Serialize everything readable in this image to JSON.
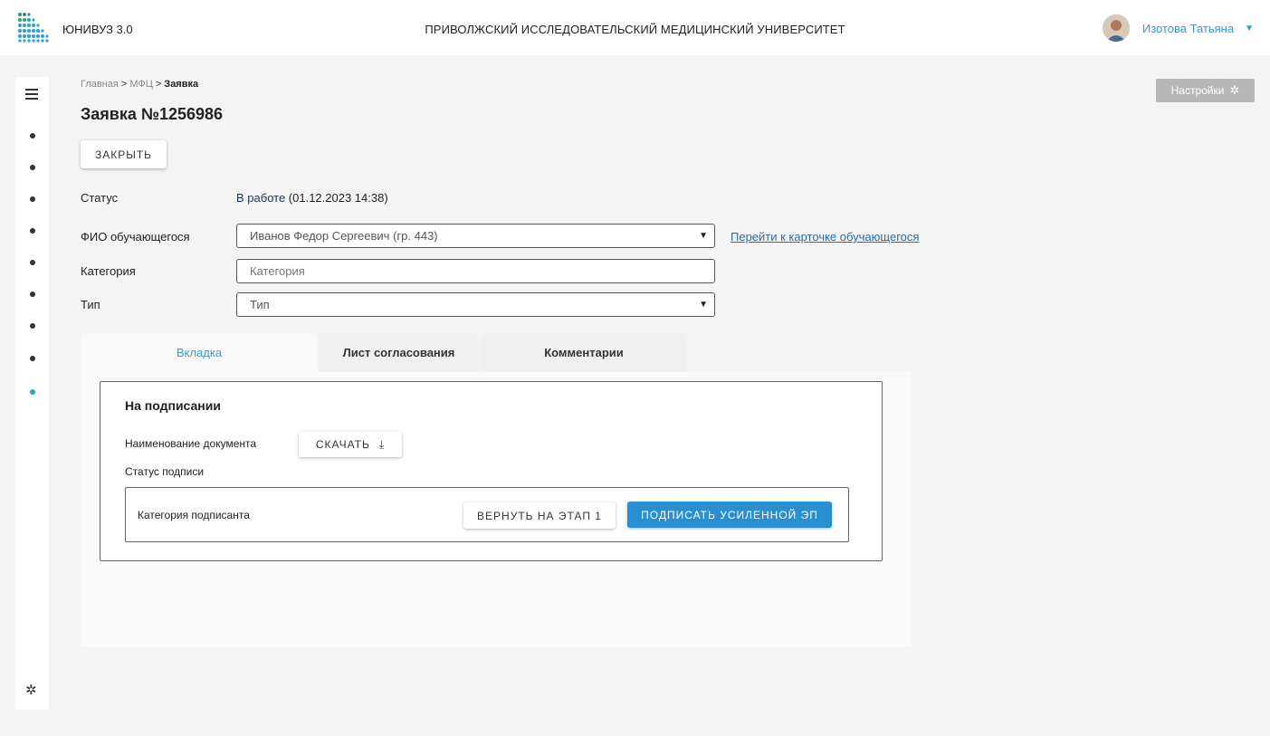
{
  "header": {
    "app_name": "ЮНИВУЗ 3.0",
    "university": "ПРИВОЛЖСКИЙ ИССЛЕДОВАТЕЛЬСКИЙ МЕДИЦИНСКИЙ УНИВЕРСИТЕТ",
    "user_name": "Изотова Татьяна",
    "user_caret": "▼"
  },
  "sidebar": {
    "icons": [
      "menu-icon",
      "dot",
      "dot",
      "dot",
      "dot",
      "dot",
      "dot",
      "dot",
      "dot",
      "dot",
      "gear-icon"
    ],
    "active_index": 8
  },
  "breadcrumb": {
    "items": [
      "Главная",
      "МФЦ",
      "Заявка"
    ],
    "separator": ">"
  },
  "page": {
    "title": "Заявка №1256986",
    "close_label": "ЗАКРЫТЬ",
    "settings_label": "Настройки"
  },
  "form": {
    "status_label": "Статус",
    "status_value": "В работе",
    "status_date": "(01.12.2023 14:38)",
    "student_label": "ФИО обучающегося",
    "student_value": "Иванов Федор Сергеевич (гр. 443)",
    "student_link": "Перейти к карточке обучающегося",
    "category_label": "Категория",
    "category_placeholder": "Категория",
    "type_label": "Тип",
    "type_value": "Тип"
  },
  "tabs": [
    {
      "label": "Вкладка",
      "active": true
    },
    {
      "label": "Лист согласования",
      "active": false
    },
    {
      "label": "Комментарии",
      "active": false
    }
  ],
  "signing": {
    "title": "На подписании",
    "doc_label": "Наименование документа",
    "download_label": "СКАЧАТЬ",
    "signature_status_label": "Статус подписи",
    "signer_category_label": "Категория подписанта",
    "return_label": "ВЕРНУТЬ НА ЭТАП 1",
    "sign_label": "ПОДПИСАТЬ УСИЛЕННОЙ ЭП"
  },
  "colors": {
    "accent": "#2a9fd6",
    "primary_button": "#2a8fd0",
    "link": "#1f6fb4",
    "settings_button": "#b7b7b7"
  }
}
